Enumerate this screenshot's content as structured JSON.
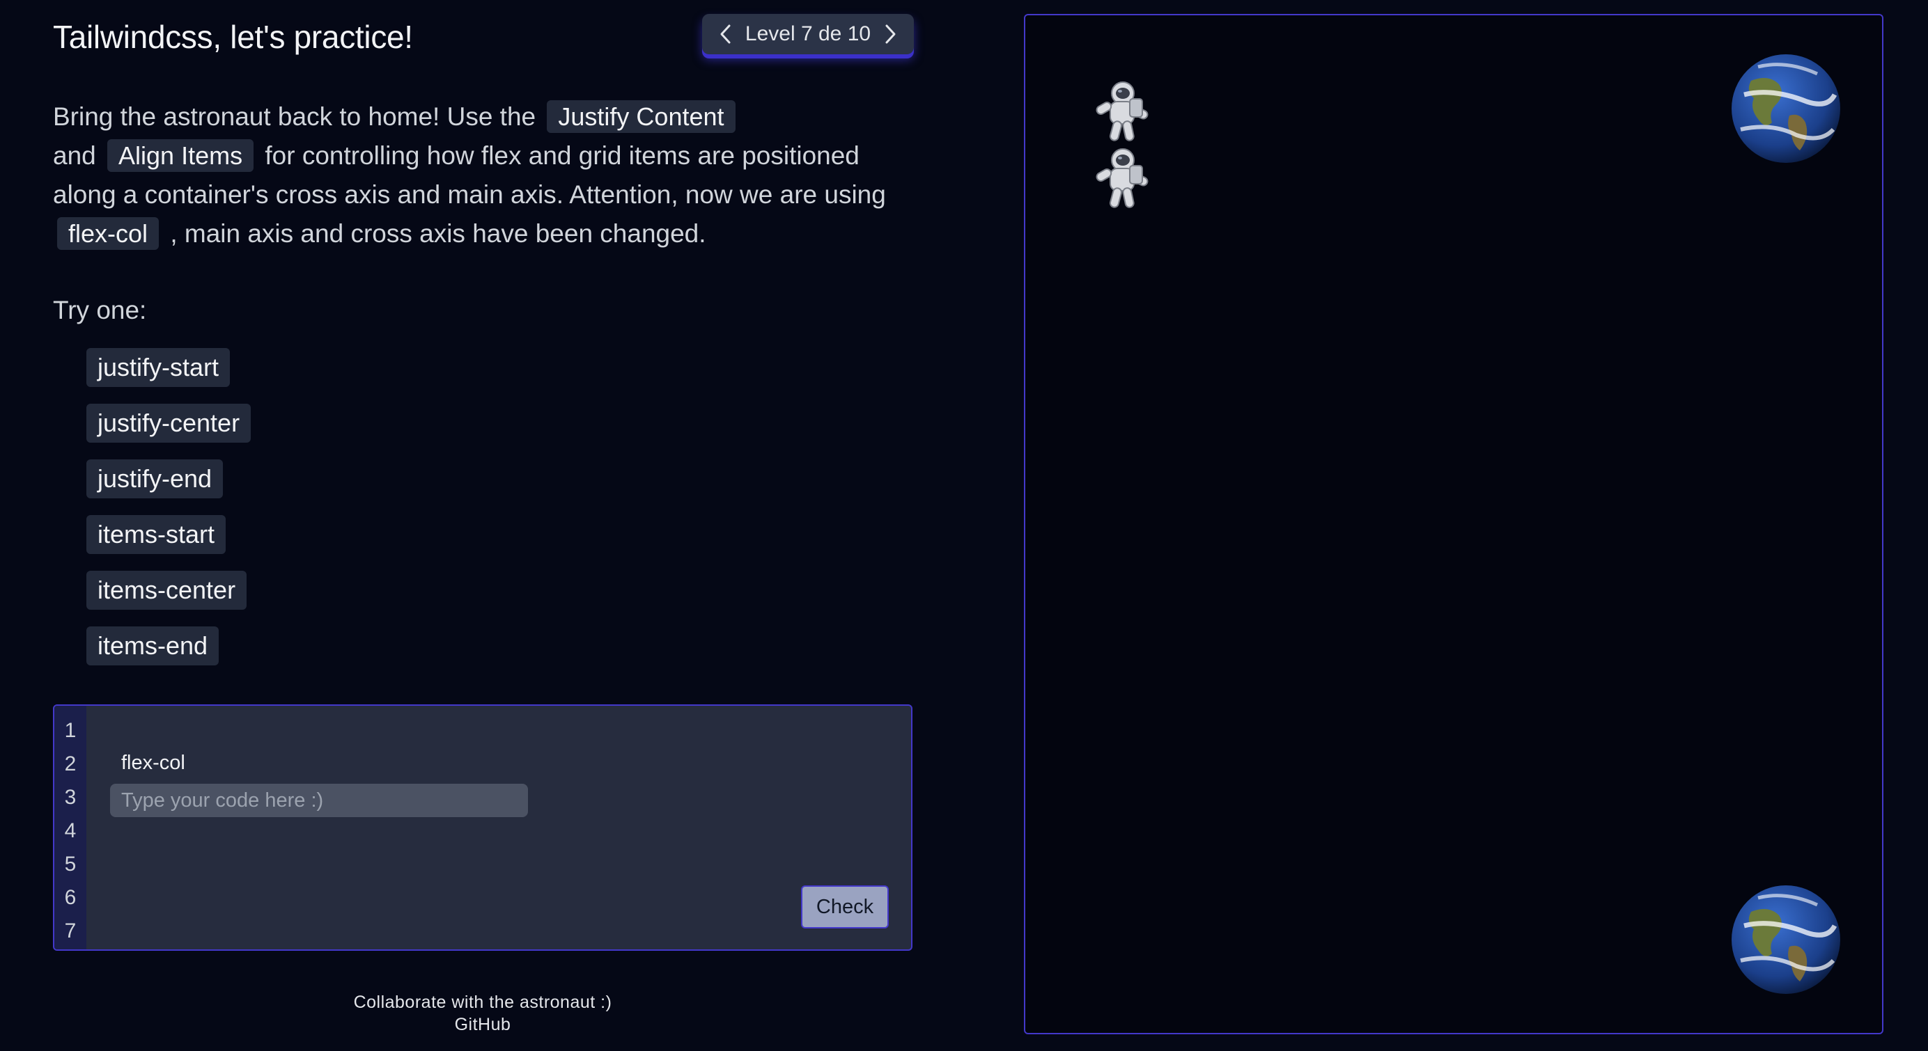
{
  "header": {
    "title": "Tailwindcss, let's practice!",
    "level_label": "Level 7 de 10"
  },
  "description": {
    "intro": "Bring the astronaut back to home! Use the",
    "code1": "Justify Content",
    "and": "and",
    "code2": "Align Items",
    "middle": "for controlling how flex and grid items are positioned along a container's cross axis and main axis. Attention, now we are using",
    "code3": "flex-col",
    "end": ", main axis and cross axis have been changed."
  },
  "try": {
    "label": "Try one:",
    "options": [
      "justify-start",
      "justify-center",
      "justify-end",
      "items-start",
      "items-center",
      "items-end"
    ]
  },
  "editor": {
    "line_numbers": [
      "1",
      "2",
      "3",
      "4",
      "5",
      "6",
      "7"
    ],
    "prefilled_class": "flex-col",
    "input_placeholder": "Type your code here :)",
    "input_value": "",
    "check_label": "Check"
  },
  "footer": {
    "text": "Collaborate with the astronaut :)",
    "link": "GitHub"
  },
  "colors": {
    "background": "#050816",
    "accent": "#4338ca",
    "code_bg": "#232a3b"
  },
  "board": {
    "astronaut_count": 2,
    "earth_count": 2
  }
}
